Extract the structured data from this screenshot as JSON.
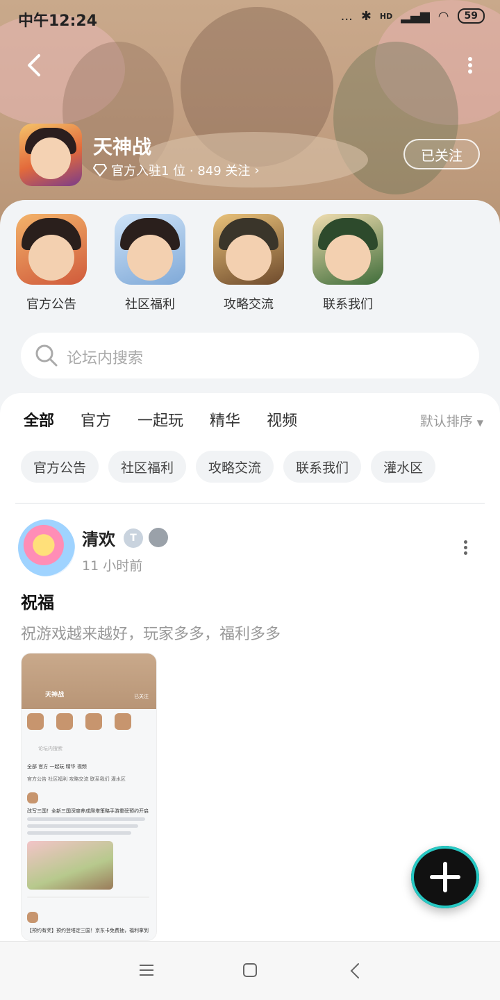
{
  "status_bar": {
    "time": "中午12:24",
    "signal_dots": "...",
    "hd": "HD",
    "battery": "59"
  },
  "header": {
    "game_name": "天神战",
    "meta": "官方入驻1 位 · 849 关注",
    "follow_label": "已关注"
  },
  "shortcuts": [
    {
      "label": "官方公告"
    },
    {
      "label": "社区福利"
    },
    {
      "label": "攻略交流"
    },
    {
      "label": "联系我们"
    }
  ],
  "search": {
    "placeholder": "论坛内搜索"
  },
  "tabs": [
    {
      "label": "全部",
      "active": true
    },
    {
      "label": "官方",
      "active": false
    },
    {
      "label": "一起玩",
      "active": false
    },
    {
      "label": "精华",
      "active": false
    },
    {
      "label": "视频",
      "active": false
    }
  ],
  "sort_label": "默认排序",
  "chips": [
    "官方公告",
    "社区福利",
    "攻略交流",
    "联系我们",
    "灌水区"
  ],
  "post": {
    "user": "清欢",
    "badge": "T",
    "time": "11 小时前",
    "title": "祝福",
    "body": "祝游戏越来越好，玩家多多，福利多多"
  },
  "thumb": {
    "game": "天神战",
    "follow": "已关注",
    "search": "论坛内搜索",
    "tabs": "全部  官方  一起玩  精华  视频",
    "chips": "官方公告  社区福利  攻略交流  联系我们  灌水区",
    "post_title": "改写三国！全新三国深度养成爬塔策略手游重磅预约开启",
    "post2": "【预约有奖】预约登塔定三国！京东卡免费抽，福利拿到"
  },
  "colors": {
    "accent": "#21d3b0",
    "fab": "#111111"
  }
}
